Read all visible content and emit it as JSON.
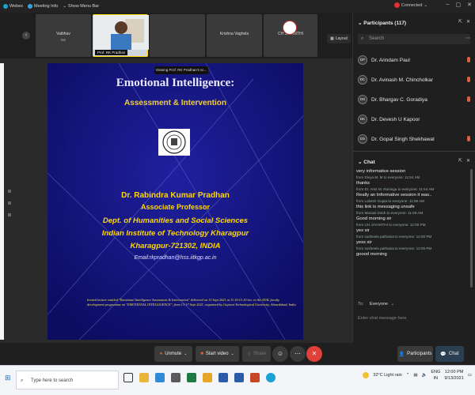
{
  "topbar": {
    "items": [
      {
        "label": "Webex",
        "color": "#1aa1d6"
      },
      {
        "label": "Meeting Info",
        "color": "#3aa0d8"
      },
      {
        "label": "Show Menu Bar",
        "color": "#888888"
      }
    ],
    "connection": "Connected"
  },
  "strip": {
    "tiles": [
      {
        "name": "Vaibhav",
        "sub": "Me"
      },
      {
        "name": "Prof. RK Pradhan",
        "sub": ""
      },
      {
        "name": "",
        "sub": ""
      },
      {
        "name": "Krishna Vaghela",
        "sub": ""
      },
      {
        "name": "CH JAYANTHI",
        "sub": ""
      },
      {
        "name": "",
        "sub": ""
      }
    ],
    "layout_label": "Layout",
    "viewing_label": "Viewing Prof. RK Pradhan's sc..."
  },
  "slide": {
    "title": "Emotional Intelligence:",
    "subtitle": "Assessment & Intervention",
    "name": "Dr. Rabindra Kumar Pradhan",
    "role": "Associate Professor",
    "dept": "Dept. of Humanities and  Social Sciences",
    "institute": "Indian Institute of Technology Kharagpur",
    "address": "Kharagpur-721302, INDIA",
    "email": "Email:rkpradhan@hss.iitkgp.ac.in",
    "footer": "Invited lecture entitled \"Emotional Intelligence Assessment & Intervention\" delivered on 13 Sept 2021 at 11.10-13.10 hrs. in the ATAL faculty development programme  on \"EMOTIONAL INTELLIGENCE\", from 13-17 Sept 2021, organized by Gujarat Technological University, Ahmedabad, India",
    "bg_color": "#12127a",
    "accent": "#ffd800"
  },
  "participants": {
    "header": "Participants (117)",
    "search_placeholder": "Search",
    "list": [
      {
        "initials": "DP",
        "name": "Dr. Arindam Paul"
      },
      {
        "initials": "DC",
        "name": "Dr. Avinash M. Chincholkar"
      },
      {
        "initials": "DG",
        "name": "Dr. Bhargav C. Goradiya"
      },
      {
        "initials": "DK",
        "name": "Dr. Devesh U Kapoor"
      },
      {
        "initials": "DS",
        "name": "Dr. Gopal Singh Shekhawat"
      }
    ]
  },
  "chat": {
    "header": "Chat",
    "messages": [
      {
        "meta": "",
        "text": "very informative session"
      },
      {
        "meta": "from Divya M. M to everyone:    11:54 AM",
        "text": "thanks"
      },
      {
        "meta": "from Dr. Amit  M. Raninga to everyone:    11:54 AM",
        "text": "Really an Informative session it was.."
      },
      {
        "meta": "from Lokesh Gupta to everyone:    11:58 AM",
        "text": "this link is messaging unsafe"
      },
      {
        "meta": "from Manasi Dash to everyone:    11:59 AM",
        "text": "Good  morning sir"
      },
      {
        "meta": "from CH JAYANTHI to everyone:    12:00 PM",
        "text": "yes sir"
      },
      {
        "meta": "from susheela pathania to everyone:    12:00 PM",
        "text": "yess sir"
      },
      {
        "meta": "from susheela pathania to everyone:    12:00 PM",
        "text": "goood morning"
      }
    ],
    "to_label": "To:",
    "to_value": "Everyone",
    "input_placeholder": "Enter chat message here"
  },
  "controls": {
    "unmute": "Unmute",
    "start_video": "Start video",
    "share": "Share",
    "participants": "Participants",
    "chat": "Chat"
  },
  "taskbar": {
    "search_placeholder": "Type here to search",
    "weather": "32°C  Light rain",
    "lang": "ENG",
    "region": "IN",
    "time": "12:00 PM",
    "date": "9/13/2021"
  }
}
